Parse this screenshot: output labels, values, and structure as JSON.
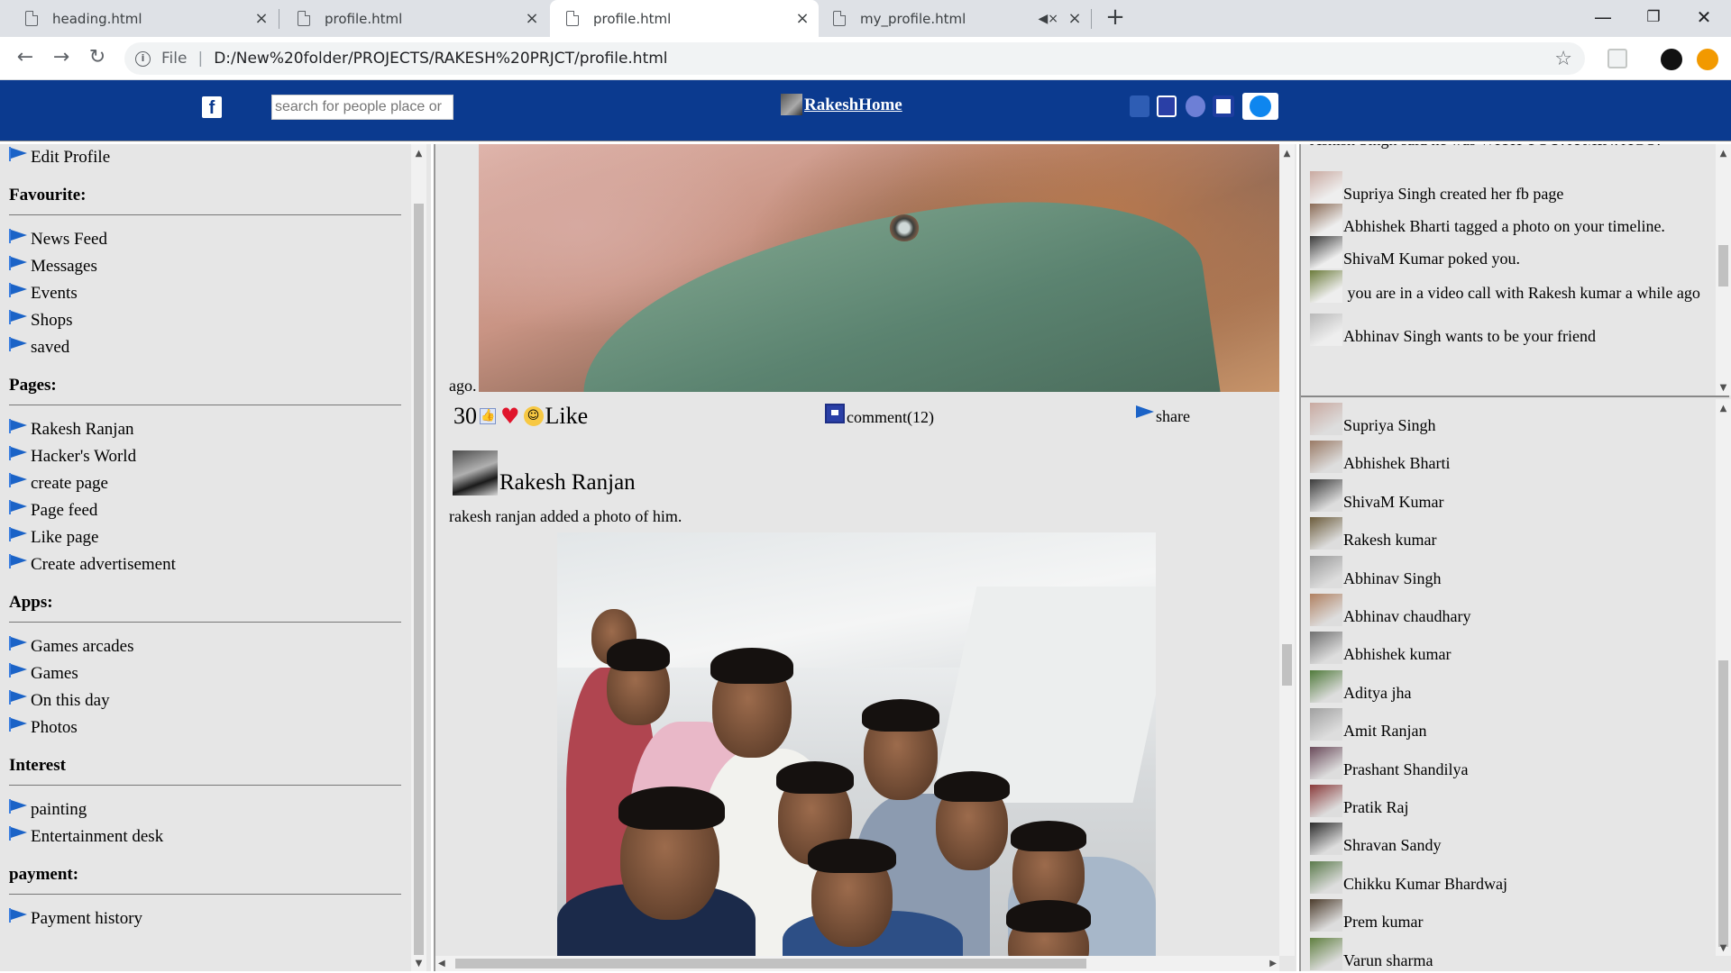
{
  "browser": {
    "tabs": [
      {
        "label": "heading.html",
        "active": false
      },
      {
        "label": "profile.html",
        "active": false
      },
      {
        "label": "profile.html",
        "active": true
      },
      {
        "label": "my_profile.html",
        "active": false,
        "muted": true
      }
    ],
    "address": {
      "scheme": "File",
      "url": "D:/New%20folder/PROJECTS/RAKESH%20PRJCT/profile.html"
    }
  },
  "header": {
    "logo": "f",
    "search_placeholder": "search for people place or",
    "brand": "RakeshHome"
  },
  "sidebar": {
    "top_item": "Edit Profile",
    "sections": [
      {
        "title": "Favourite:",
        "items": [
          "News Feed",
          "Messages",
          "Events",
          "Shops",
          "saved"
        ]
      },
      {
        "title": "Pages:",
        "items": [
          "Rakesh Ranjan",
          "Hacker's World",
          "create page",
          "Page feed",
          "Like page",
          "Create advertisement"
        ]
      },
      {
        "title": "Apps:",
        "items": [
          "Games arcades",
          "Games",
          "On this day",
          "Photos"
        ]
      },
      {
        "title": "Interest",
        "items": [
          "painting",
          "Entertainment desk"
        ]
      },
      {
        "title": "payment:",
        "items": [
          "Payment history"
        ]
      }
    ]
  },
  "feed": {
    "post1": {
      "ago": "ago.",
      "like_count": "30",
      "like_label": "Like",
      "comment_label": "comment(12)",
      "share_label": "share"
    },
    "post2": {
      "author": "Rakesh Ranjan",
      "caption": "rakesh ranjan added a photo of him."
    }
  },
  "notifications": [
    {
      "text": "Ashish Singh said he was WITH YOU. A MIN. AGO.",
      "avatar": false
    },
    {
      "text": "Supriya Singh created her fb page",
      "avatar": true
    },
    {
      "text": "Abhishek Bharti tagged a photo on your timeline.",
      "avatar": true
    },
    {
      "text": "ShivaM Kumar poked you.",
      "avatar": true
    },
    {
      "text": " you are in a video call with Rakesh kumar a while ago",
      "avatar": true
    },
    {
      "text": "Abhinav Singh wants to be your friend",
      "avatar": true
    }
  ],
  "friends": [
    "Supriya Singh",
    "Abhishek Bharti",
    "ShivaM Kumar",
    "Rakesh kumar",
    "Abhinav Singh",
    "Abhinav chaudhary",
    "Abhishek kumar",
    "Aditya jha",
    "Amit Ranjan",
    "Prashant Shandilya",
    "Pratik Raj",
    "Shravan Sandy",
    "Chikku Kumar Bhardwaj",
    "Prem kumar",
    "Varun sharma"
  ],
  "colors": {
    "header_bg": "#0b3a8f",
    "panel_bg": "#e6e6e6",
    "menu_flag": "#1b63c7"
  }
}
